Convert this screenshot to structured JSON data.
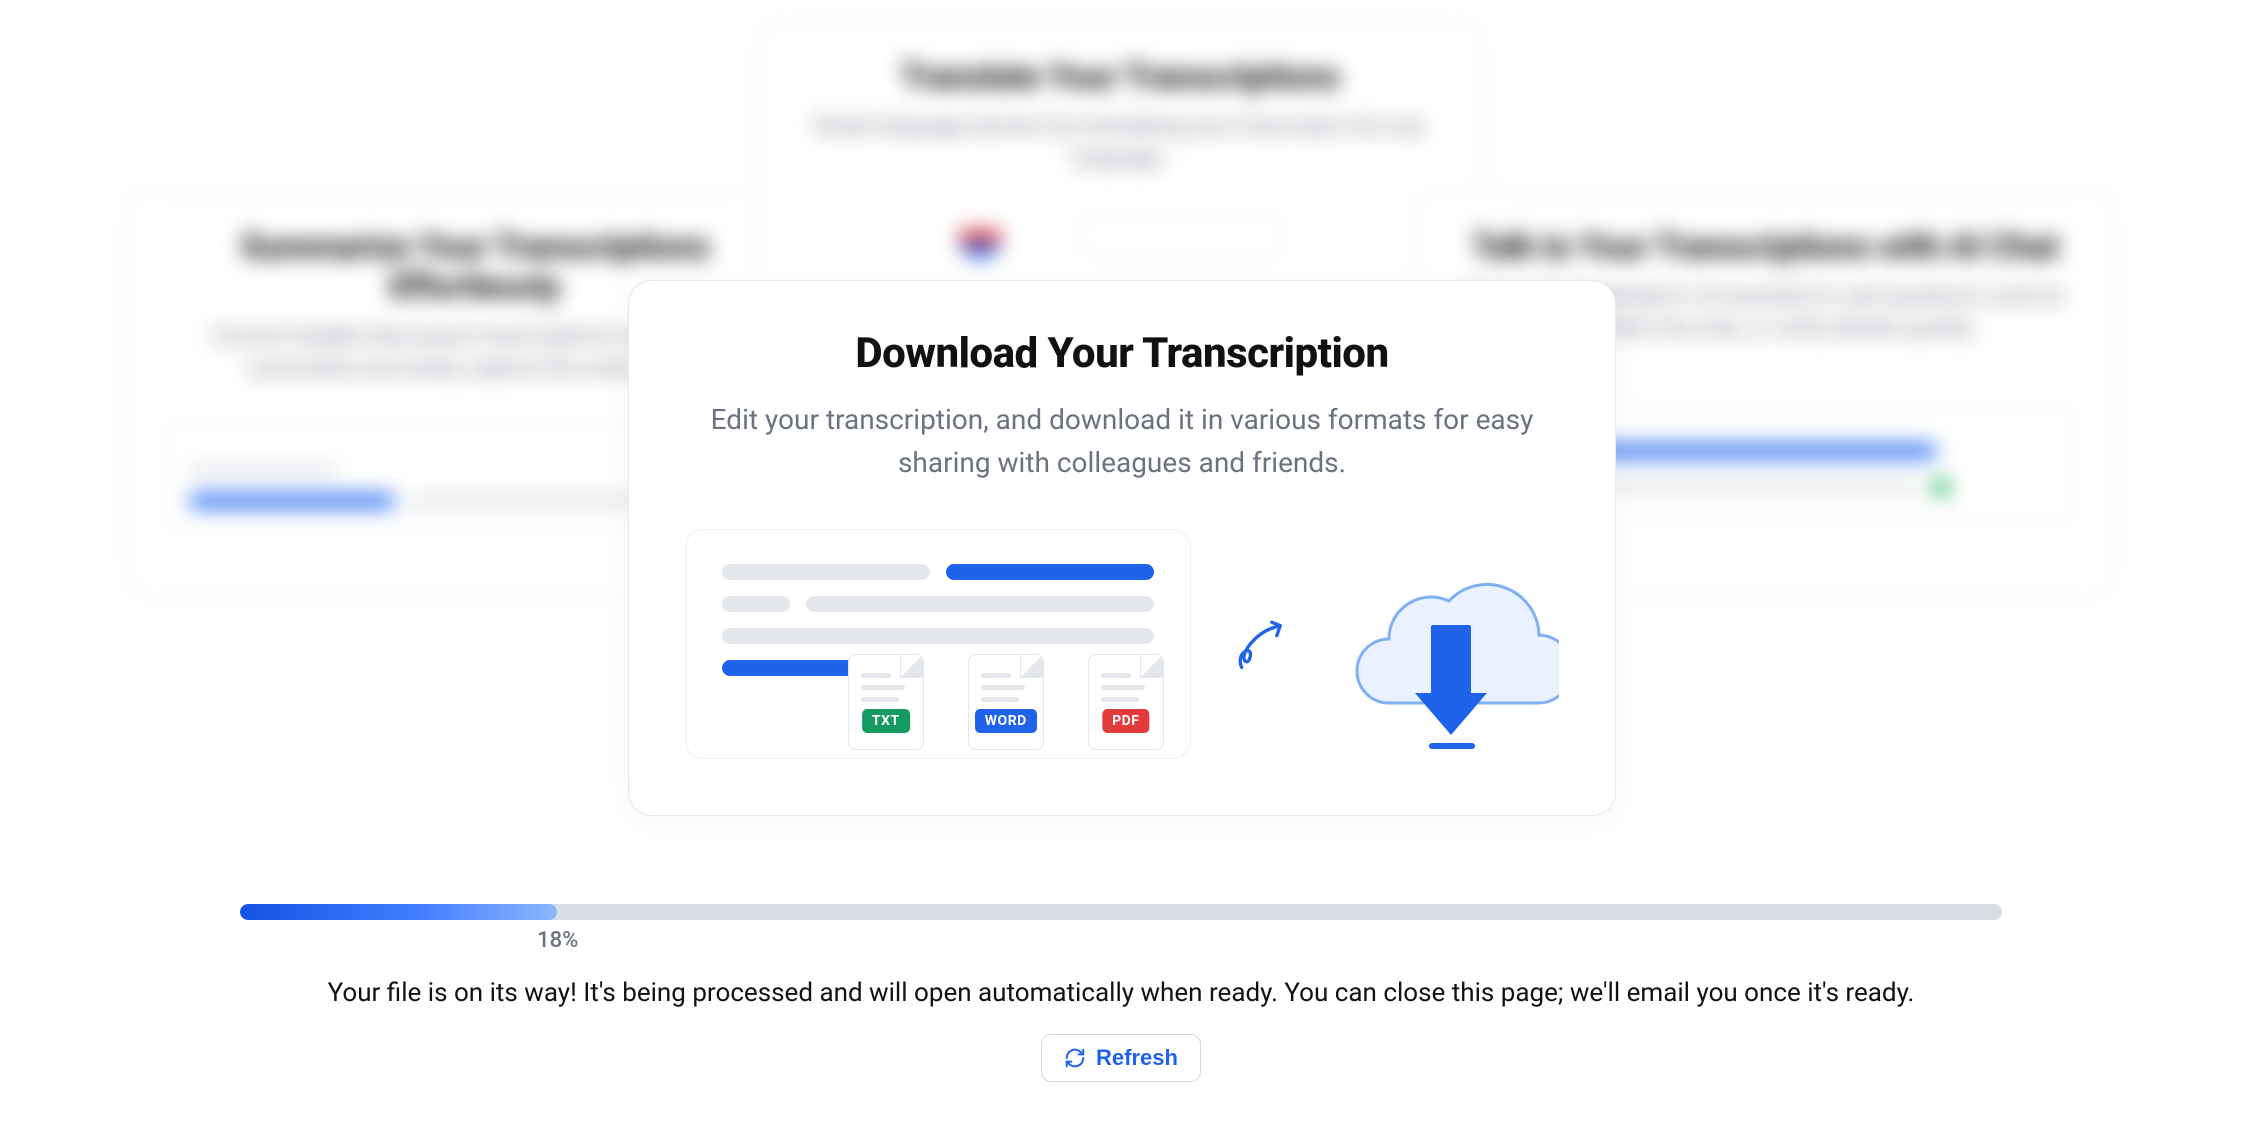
{
  "background_cards": {
    "left": {
      "title": "Summarize Your Transcriptions Effortlessly",
      "desc": "Convert lengthy discussion transcriptions into concise summaries and easily capture the main points."
    },
    "top": {
      "title": "Translate Your Transcriptions",
      "desc": "Break language barriers by translating your transcripts into any language."
    },
    "right": {
      "title": "Talk to Your Transcriptions with AI Chat",
      "desc": "Chat with Transkriptor's AI assistant to ask questions, look for info within the chat, or verify details quickly."
    }
  },
  "main_card": {
    "title": "Download Your Transcription",
    "desc": "Edit your transcription, and download it in various formats for easy sharing with colleagues and friends.",
    "formats": {
      "txt": "TXT",
      "word": "WORD",
      "pdf": "PDF"
    }
  },
  "progress": {
    "percent": 18,
    "percent_label": "18%"
  },
  "status_message": "Your file is on its way! It's being processed and will open automatically when ready. You can close this page; we'll email you once it's ready.",
  "refresh_label": "Refresh"
}
